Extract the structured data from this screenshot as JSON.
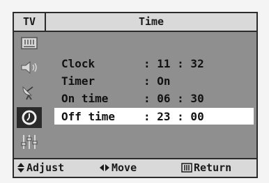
{
  "header": {
    "tv_label": "TV",
    "title": "Time"
  },
  "sidebar": {
    "icons": [
      "picture-icon",
      "sound-icon",
      "channel-antenna-icon",
      "time-clock-icon",
      "setup-sliders-icon"
    ],
    "active": "time-clock-icon"
  },
  "menu": {
    "items": [
      {
        "label": "Clock",
        "value": ": 11 : 32"
      },
      {
        "label": "Timer",
        "value": ": On"
      },
      {
        "label": "On time",
        "value": ": 06 : 30"
      },
      {
        "label": "Off time",
        "value": ": 23 : 00"
      }
    ],
    "selected_index": 3
  },
  "footer": {
    "adjust": "Adjust",
    "move": "Move",
    "return": "Return"
  },
  "colors": {
    "panel": "#8f8f8f",
    "bar": "#d9d9d9",
    "selected_row": "#ffffff",
    "active_icon_bg": "#2a2a2a"
  }
}
